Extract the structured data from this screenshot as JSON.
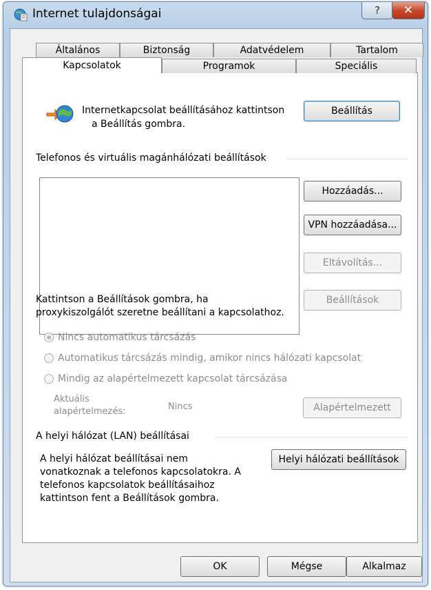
{
  "window": {
    "title": "Internet tulajdonságai",
    "help_label": "?",
    "close_label": "✕"
  },
  "tabs": {
    "row1": [
      "Általános",
      "Biztonság",
      "Adatvédelem",
      "Tartalom"
    ],
    "row2": [
      "Kapcsolatok",
      "Programok",
      "Speciális"
    ],
    "active": "Kapcsolatok"
  },
  "connection": {
    "setup_text_line1": "Internetkapcsolat beállításához kattintson",
    "setup_text_line2": "a Beállítás gombra.",
    "setup_button": "Beállítás"
  },
  "dialup": {
    "group_label": "Telefonos és virtuális magánhálózati beállítások",
    "add_button": "Hozzáadás...",
    "add_vpn_button": "VPN hozzáadása...",
    "remove_button": "Eltávolítás...",
    "settings_button": "Beállítások",
    "proxy_text_line1": "Kattintson a Beállítások gombra, ha",
    "proxy_text_line2": "proxykiszolgálót szeretne beállítani a kapcsolathoz.",
    "radio_never": "Nincs automatikus tárcsázás",
    "radio_when_no_network": "Automatikus tárcsázás mindig, amikor nincs hálózati kapcsolat",
    "radio_always": "Mindig az alapértelmezett kapcsolat tárcsázása",
    "current_default_label_line1": "Aktuális",
    "current_default_label_line2": "alapértelmezés:",
    "current_default_value": "Nincs",
    "set_default_button": "Alapértelmezett"
  },
  "lan": {
    "group_label": "A helyi hálózat (LAN) beállításai",
    "text_line1": "A helyi hálózat beállításai nem",
    "text_line2": "vonatkoznak a telefonos kapcsolatokra. A",
    "text_line3": "telefonos kapcsolatok beállításaihoz",
    "text_line4": "kattintson fent a Beállítások gombra.",
    "lan_button": "Helyi hálózati beállítások"
  },
  "footer": {
    "ok_button": "OK",
    "cancel_button": "Mégse",
    "apply_button": "Alkalmaz"
  },
  "icons": {
    "title_icon": "internet-options-icon",
    "connection_icon": "globe-connection-icon"
  }
}
